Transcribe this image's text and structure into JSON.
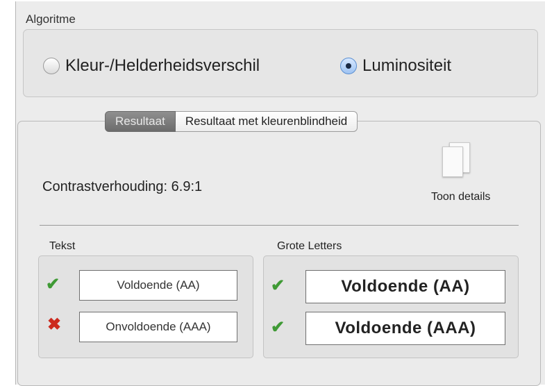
{
  "algorithm": {
    "group_label": "Algoritme",
    "options": [
      {
        "label": "Kleur-/Helderheidsverschil",
        "selected": false
      },
      {
        "label": "Luminositeit",
        "selected": true
      }
    ]
  },
  "tabs": [
    {
      "label": "Resultaat",
      "active": true
    },
    {
      "label": "Resultaat met kleurenblindheid",
      "active": false
    }
  ],
  "result": {
    "contrast_text": "Contrastverhouding: 6.9:1",
    "details_button_label": "Toon details"
  },
  "text_section": {
    "label": "Tekst",
    "rows": [
      {
        "status": "pass",
        "icon": "check-icon",
        "value": "Voldoende (AA)"
      },
      {
        "status": "fail",
        "icon": "cross-icon",
        "value": "Onvoldoende (AAA)"
      }
    ]
  },
  "large_section": {
    "label": "Grote Letters",
    "rows": [
      {
        "status": "pass",
        "icon": "check-icon",
        "value": "Voldoende (AA)"
      },
      {
        "status": "pass",
        "icon": "check-icon",
        "value": "Voldoende (AAA)"
      }
    ]
  },
  "colors": {
    "pass": "#3f9a35",
    "fail": "#cc2a1e",
    "active_tab": "#7a7a7a",
    "radio_selected": "#5a8ed0"
  }
}
